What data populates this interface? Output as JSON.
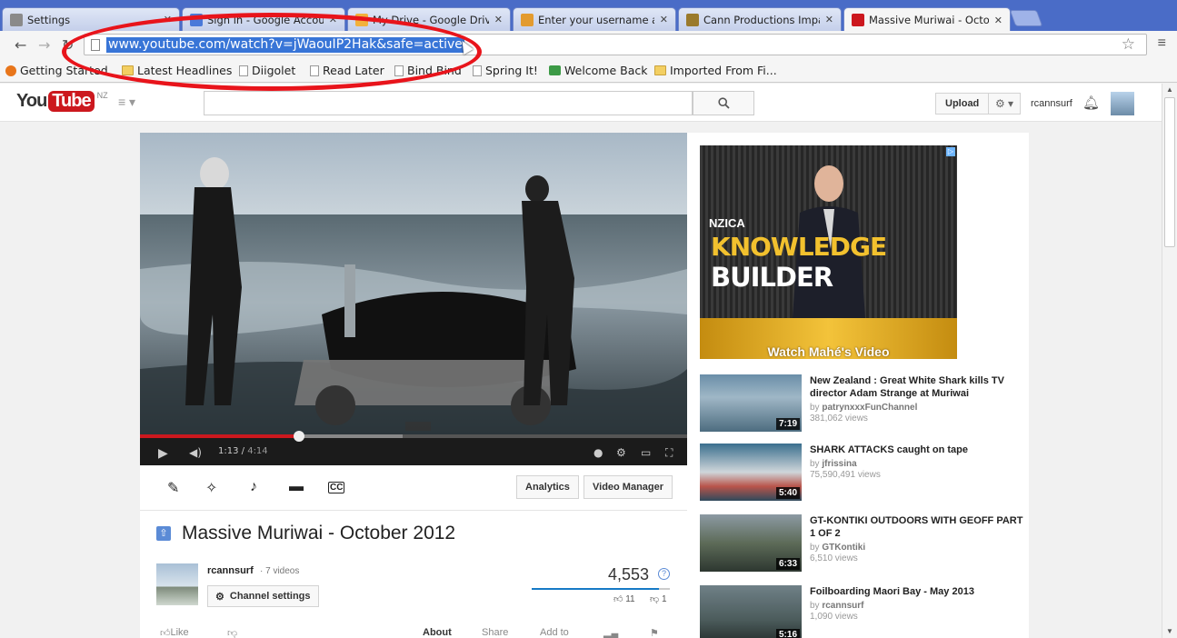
{
  "browser": {
    "tabs": [
      {
        "label": "Settings",
        "icon": "wrench-icon",
        "color": "#7a7a7a"
      },
      {
        "label": "Sign in - Google Accounts",
        "icon": "google-icon",
        "color": "#4a79d9"
      },
      {
        "label": "My Drive - Google Drive",
        "icon": "drive-icon",
        "color": "#f2b23c"
      },
      {
        "label": "Enter your username and",
        "icon": "feather-icon",
        "color": "#e39b2f"
      },
      {
        "label": "Cann Productions Impact",
        "icon": "leaf-icon",
        "color": "#9a7a2c"
      },
      {
        "label": "Massive Muriwai - Octobe",
        "icon": "youtube-icon",
        "color": "#cc181e"
      }
    ],
    "url": "www.youtube.com/watch?v=jWaouIP2Hak&safe=active",
    "bookmarks": [
      {
        "label": "Getting Started",
        "icon": "firefox-icon"
      },
      {
        "label": "Latest Headlines",
        "icon": "folder-icon"
      },
      {
        "label": "Diigolet",
        "icon": "page-icon"
      },
      {
        "label": "Read Later",
        "icon": "page-icon"
      },
      {
        "label": "Bind Bind",
        "icon": "page-icon"
      },
      {
        "label": "Spring It!",
        "icon": "page-icon"
      },
      {
        "label": "Welcome Back",
        "icon": "app-icon"
      },
      {
        "label": "Imported From Fi...",
        "icon": "folder-icon"
      }
    ]
  },
  "youtube": {
    "logo_you": "You",
    "logo_tube": "Tube",
    "region": "NZ",
    "upload_label": "Upload",
    "username": "rcannsurf"
  },
  "player": {
    "time_current": "1:13",
    "time_total": "4:14",
    "progress_fraction": 0.29,
    "buffer_fraction": 0.48
  },
  "actions": {
    "analytics_label": "Analytics",
    "video_manager_label": "Video Manager"
  },
  "video": {
    "title": "Massive Muriwai - October 2012",
    "channel": "rcannsurf",
    "channel_videos": "· 7 videos",
    "channel_settings_label": "Channel settings",
    "views": "4,553",
    "likes": "11",
    "dislikes": "1",
    "like_fraction": 0.92,
    "like_label": "Like",
    "tabs": [
      "About",
      "Share",
      "Add to"
    ]
  },
  "ad": {
    "line1": "NZICA",
    "line2": "KNOWLEDGE",
    "line3": "BUILDER",
    "cta": "Watch Mahé's Video"
  },
  "related": [
    {
      "title": "New Zealand : Great White Shark kills TV director Adam Strange at Muriwai",
      "by": "by",
      "channel": "patrynxxxFunChannel",
      "views": "381,062 views",
      "duration": "7:19"
    },
    {
      "title": "SHARK ATTACKS caught on tape",
      "by": "by",
      "channel": "jfrissina",
      "views": "75,590,491 views",
      "duration": "5:40"
    },
    {
      "title": "GT-KONTIKI OUTDOORS WITH GEOFF PART 1 OF 2",
      "by": "by",
      "channel": "GTKontiki",
      "views": "6,510 views",
      "duration": "6:33"
    },
    {
      "title": "Foilboarding Maori Bay - May 2013",
      "by": "by",
      "channel": "rcannsurf",
      "views": "1,090 views",
      "duration": "5:16"
    }
  ]
}
